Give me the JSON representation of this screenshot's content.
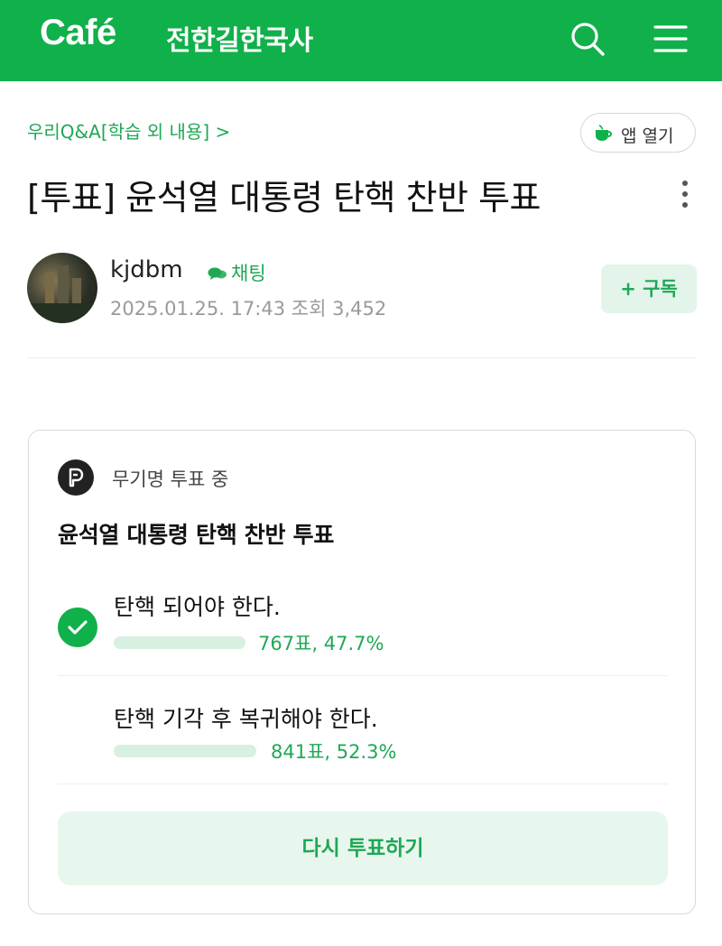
{
  "header": {
    "logo": "Café",
    "cafe_name": "전한길한국사"
  },
  "board": {
    "name": "우리Q&A[학습 외 내용] >",
    "app_open_label": "앱 열기"
  },
  "post": {
    "title": "[투표] 윤석열 대통령 탄핵 찬반 투표",
    "author": "kjdbm",
    "chat_label": "채팅",
    "date": "2025.01.25. 17:43",
    "views": "조회 3,452",
    "subscribe_label": "+ 구독"
  },
  "poll": {
    "status": "무기명 투표 중",
    "title": "윤석열 대통령 탄핵 찬반 투표",
    "options": [
      {
        "label": "탄핵 되어야 한다.",
        "stat": "767표, 47.7%",
        "votes": 767,
        "percent": 47.7,
        "selected": true
      },
      {
        "label": "탄핵 기각 후 복귀해야 한다.",
        "stat": "841표, 52.3%",
        "votes": 841,
        "percent": 52.3,
        "selected": false
      }
    ],
    "revote_label": "다시 투표하기"
  },
  "colors": {
    "brand_green": "#10b04a",
    "accent_text_green": "#1fa856",
    "bar_fill": "#d8f0e0",
    "button_tint": "#e8f7ee"
  },
  "icons": [
    "search-icon",
    "menu-icon",
    "cup-icon",
    "more-vertical-icon",
    "chat-icon",
    "poll-icon",
    "check-icon"
  ]
}
